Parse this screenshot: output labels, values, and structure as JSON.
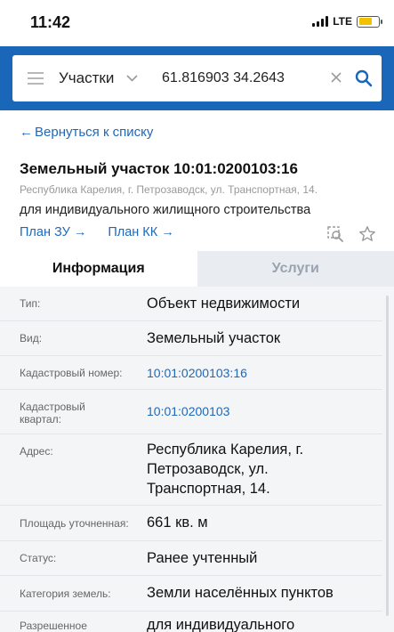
{
  "status_bar": {
    "time": "11:42",
    "network": "LTE",
    "battery_level": 0.7
  },
  "search": {
    "layer": "Участки",
    "query": "61.816903 34.2643",
    "icons": {
      "menu": "menu-icon",
      "chevron": "chevron-down-icon",
      "clear": "close-icon",
      "search": "search-icon"
    }
  },
  "back_link": {
    "arrow": "←",
    "label": "Вернуться к списку"
  },
  "object": {
    "title": "Земельный участок 10:01:0200103:16",
    "address": "Республика Карелия, г. Петрозаводск, ул. Транспортная, 14.",
    "purpose": "для индивидуального жилищного строительства",
    "links": [
      {
        "label": "План ЗУ",
        "arrow": "→"
      },
      {
        "label": "План КК",
        "arrow": "→"
      }
    ],
    "tool_icons": [
      "zoom-to-object-icon",
      "star-icon"
    ]
  },
  "tabs": [
    {
      "label": "Информация",
      "active": true
    },
    {
      "label": "Услуги",
      "active": false
    }
  ],
  "info": [
    {
      "label": "Тип:",
      "value": "Объект недвижимости"
    },
    {
      "label": "Вид:",
      "value": "Земельный участок"
    },
    {
      "label": "Кадастровый номер:",
      "value": "10:01:0200103:16",
      "link": true
    },
    {
      "label": "Кадастровый квартал:",
      "value": "10:01:0200103",
      "link": true
    },
    {
      "label": "Адрес:",
      "value": "Республика Карелия, г. Петрозаводск, ул. Транспортная, 14."
    },
    {
      "label": "Площадь уточненная:",
      "value": "661 кв. м"
    },
    {
      "label": "Статус:",
      "value": "Ранее учтенный"
    },
    {
      "label": "Категория земель:",
      "value": "Земли населённых пунктов"
    },
    {
      "label": "Разрешенное",
      "value": "для индивидуального"
    }
  ],
  "colors": {
    "accent": "#1a66b8",
    "link": "#1f68b8",
    "panel_bg": "#f4f5f7",
    "inactive_tab_bg": "#e9edf2"
  }
}
